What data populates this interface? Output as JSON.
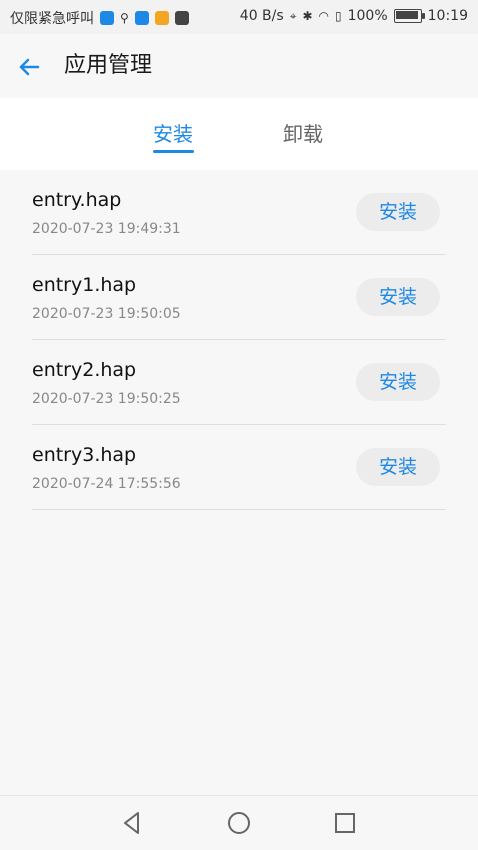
{
  "status_bar": {
    "carrier": "仅限紧急呼叫",
    "net_speed": "40 B/s",
    "battery": "100%",
    "time": "10:19"
  },
  "header": {
    "title": "应用管理"
  },
  "tabs": [
    {
      "label": "安装",
      "active": true
    },
    {
      "label": "卸载",
      "active": false
    }
  ],
  "files": [
    {
      "name": "entry.hap",
      "time": "2020-07-23 19:49:31",
      "action": "安装"
    },
    {
      "name": "entry1.hap",
      "time": "2020-07-23 19:50:05",
      "action": "安装"
    },
    {
      "name": "entry2.hap",
      "time": "2020-07-23 19:50:25",
      "action": "安装"
    },
    {
      "name": "entry3.hap",
      "time": "2020-07-24 17:55:56",
      "action": "安装"
    }
  ],
  "colors": {
    "accent": "#1e88e5",
    "background": "#f7f7f7"
  },
  "icons": {
    "back": "arrow-left-icon",
    "nav_back": "triangle-back-icon",
    "nav_home": "circle-home-icon",
    "nav_recent": "square-recent-icon"
  }
}
